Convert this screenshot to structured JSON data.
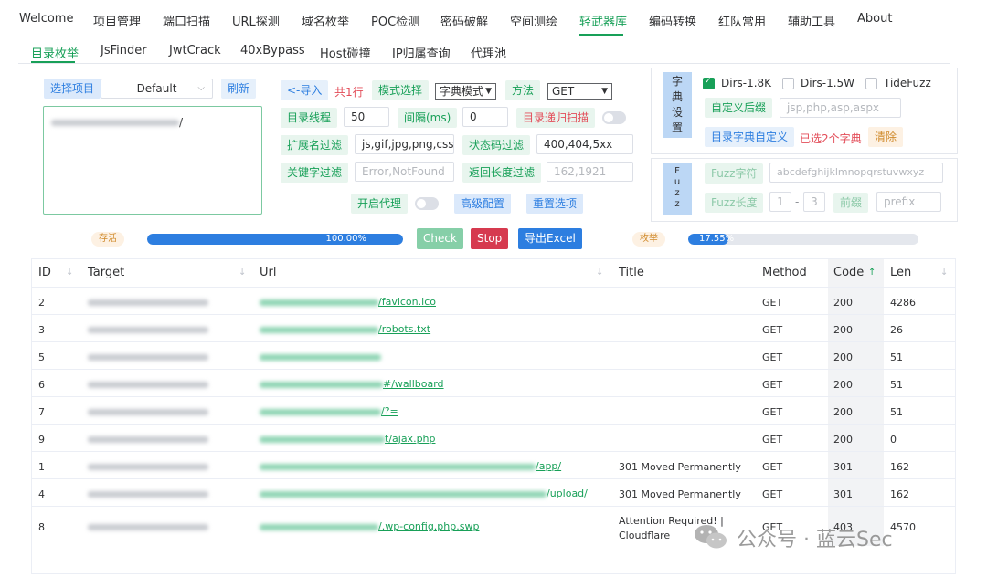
{
  "top_nav": [
    {
      "label": "Welcome",
      "active": false
    },
    {
      "label": "项目管理",
      "active": false
    },
    {
      "label": "端口扫描",
      "active": false
    },
    {
      "label": "URL探测",
      "active": false
    },
    {
      "label": "域名枚举",
      "active": false
    },
    {
      "label": "POC检测",
      "active": false
    },
    {
      "label": "密码破解",
      "active": false
    },
    {
      "label": "空间测绘",
      "active": false
    },
    {
      "label": "轻武器库",
      "active": true
    },
    {
      "label": "编码转换",
      "active": false
    },
    {
      "label": "红队常用",
      "active": false
    },
    {
      "label": "辅助工具",
      "active": false
    },
    {
      "label": "About",
      "active": false
    }
  ],
  "sub_nav": [
    {
      "label": "目录枚举",
      "active": true
    },
    {
      "label": "JsFinder",
      "active": false
    },
    {
      "label": "JwtCrack",
      "active": false
    },
    {
      "label": "40xBypass",
      "active": false
    },
    {
      "label": "Host碰撞",
      "active": false
    },
    {
      "label": "IP归属查询",
      "active": false
    },
    {
      "label": "代理池",
      "active": false
    }
  ],
  "project": {
    "select_label": "选择项目",
    "select_value": "Default",
    "refresh": "刷新",
    "url_suffix": "/"
  },
  "options": {
    "import": "<-导入",
    "count": "共1行",
    "mode_label": "模式选择",
    "mode_value": "字典模式",
    "method_label": "方法",
    "method_value": "GET",
    "threads_label": "目录线程",
    "threads_value": "50",
    "interval_label": "间隔(ms)",
    "interval_value": "0",
    "recursive_label": "目录递归扫描",
    "ext_label": "扩展名过滤",
    "ext_value": "js,gif,jpg,png,css",
    "status_label": "状态码过滤",
    "status_value": "400,404,5xx",
    "keyword_label": "关键字过滤",
    "keyword_placeholder": "Error,NotFound",
    "length_label": "返回长度过滤",
    "length_placeholder": "162,1921",
    "proxy_label": "开启代理",
    "advanced": "高级配置",
    "reset": "重置选项"
  },
  "dict_panel": {
    "title_chars": [
      "字",
      "典",
      "设",
      "置"
    ],
    "checks": [
      {
        "label": "Dirs-1.8K",
        "checked": true
      },
      {
        "label": "Dirs-1.5W",
        "checked": false
      },
      {
        "label": "TideFuzz",
        "checked": false
      }
    ],
    "custom_suffix": "自定义后缀",
    "suffix_placeholder": "jsp,php,asp,aspx",
    "custom_dict": "目录字典自定义",
    "selected": "已选2个字典",
    "clear": "清除"
  },
  "fuzz_panel": {
    "title_chars": [
      "F",
      "u",
      "z",
      "z"
    ],
    "char_label": "Fuzz字符",
    "char_placeholder": "abcdefghijklmnopqrstuvwxyz",
    "len_label": "Fuzz长度",
    "len_min": "1",
    "len_sep": "-",
    "len_max": "3",
    "prefix_label": "前缀",
    "prefix_placeholder": "prefix"
  },
  "progress": {
    "alive_label": "存活",
    "alive_percent": 100,
    "alive_text": "100.00%",
    "check": "Check",
    "stop": "Stop",
    "export": "导出Excel",
    "enum_label": "枚举",
    "enum_percent": 17.55,
    "enum_text": "17.55%"
  },
  "table": {
    "headers": {
      "id": "ID",
      "target": "Target",
      "url": "Url",
      "title": "Title",
      "method": "Method",
      "code": "Code",
      "len": "Len"
    },
    "rows": [
      {
        "id": "2",
        "url": "/favicon.ico",
        "title": "",
        "method": "GET",
        "code": "200",
        "len": "4286"
      },
      {
        "id": "3",
        "url": "/robots.txt",
        "title": "",
        "method": "GET",
        "code": "200",
        "len": "26"
      },
      {
        "id": "5",
        "url": "",
        "title": "",
        "method": "GET",
        "code": "200",
        "len": "51"
      },
      {
        "id": "6",
        "url": "#/wallboard",
        "title": "",
        "method": "GET",
        "code": "200",
        "len": "51"
      },
      {
        "id": "7",
        "url": "/?=",
        "title": "",
        "method": "GET",
        "code": "200",
        "len": "51"
      },
      {
        "id": "9",
        "url": "t/ajax.php",
        "title": "",
        "method": "GET",
        "code": "200",
        "len": "0"
      },
      {
        "id": "1",
        "url": "/app/",
        "title": "301 Moved Permanently",
        "method": "GET",
        "code": "301",
        "len": "162"
      },
      {
        "id": "4",
        "url": "/upload/",
        "title": "301 Moved Permanently",
        "method": "GET",
        "code": "301",
        "len": "162"
      },
      {
        "id": "8",
        "url": "/.wp-config.php.swp",
        "title": "Attention Required! | Cloudflare",
        "method": "GET",
        "code": "403",
        "len": "4570"
      }
    ]
  },
  "watermark": "公众号 · 蓝云Sec"
}
